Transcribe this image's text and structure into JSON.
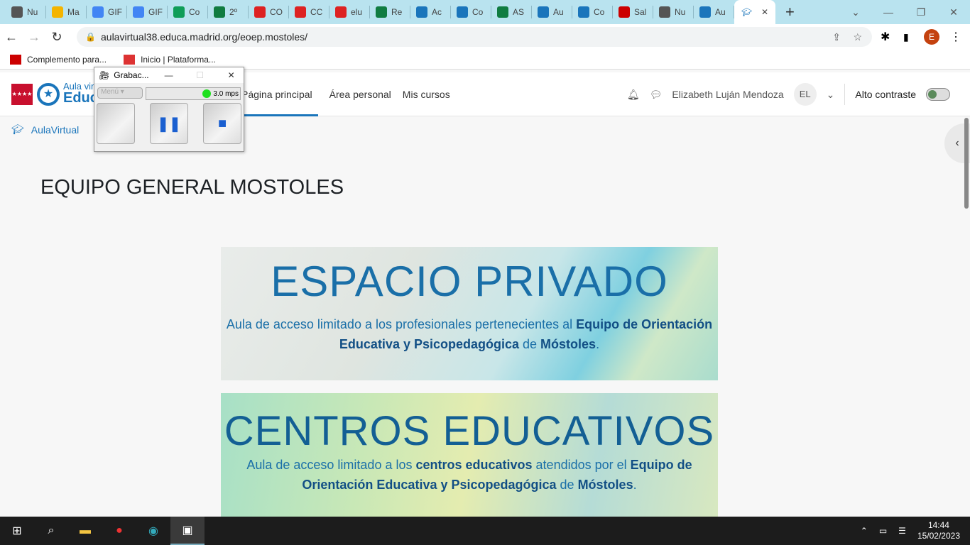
{
  "browser": {
    "tabs": [
      "Nu",
      "Ma",
      "GIF",
      "GIF",
      "Co",
      "2º",
      "CO",
      "CC",
      "elu",
      "Re",
      "Ac",
      "Co",
      "AS",
      "Au",
      "Co",
      "Sal",
      "Nu",
      "Au"
    ],
    "tab_colors": [
      "#555",
      "#f4b400",
      "#4285f4",
      "#4285f4",
      "#0f9d58",
      "#107c41",
      "#d22",
      "#d22",
      "#d22",
      "#107c41",
      "#1a75bb",
      "#1a75bb",
      "#107c41",
      "#1a75bb",
      "#1a75bb",
      "#c00",
      "#555",
      "#1a75bb"
    ],
    "active_tab_close": "✕",
    "new_tab": "+",
    "url": "aulavirtual38.educa.madrid.org/eoep.mostoles/",
    "bookmarks": [
      "Complemento para...",
      "Inicio | Plataforma..."
    ]
  },
  "header": {
    "logo_line1": "Aula virtual",
    "logo_line2": "Educa",
    "menu": [
      "Página principal",
      "Área personal",
      "Mis cursos"
    ],
    "user": "Elizabeth Luján Mendoza",
    "initials": "EL",
    "contrast": "Alto contraste"
  },
  "breadcrumb": "AulaVirtual",
  "page_title": "EQUIPO GENERAL MOSTOLES",
  "banner1": {
    "title": "ESPACIO PRIVADO",
    "t1": "Aula de acceso limitado a los profesionales pertenecientes al ",
    "b1": "Equipo de Orientación Educativa y Psicopedagógica",
    "t2": " de ",
    "b2": "Móstoles",
    "t3": "."
  },
  "banner2": {
    "title": "CENTROS EDUCATIVOS",
    "t1": "Aula de acceso limitado a los ",
    "b1": "centros educativos",
    "t2": " atendidos por el ",
    "b2": "Equipo de Orientación Educativa y Psicopedagógica",
    "t3": " de ",
    "b3": "Móstoles",
    "t4": "."
  },
  "recorder": {
    "title": "Grabac...",
    "menu": "Menú",
    "rate": "3.0 mps"
  },
  "taskbar": {
    "time": "14:44",
    "date": "15/02/2023"
  }
}
